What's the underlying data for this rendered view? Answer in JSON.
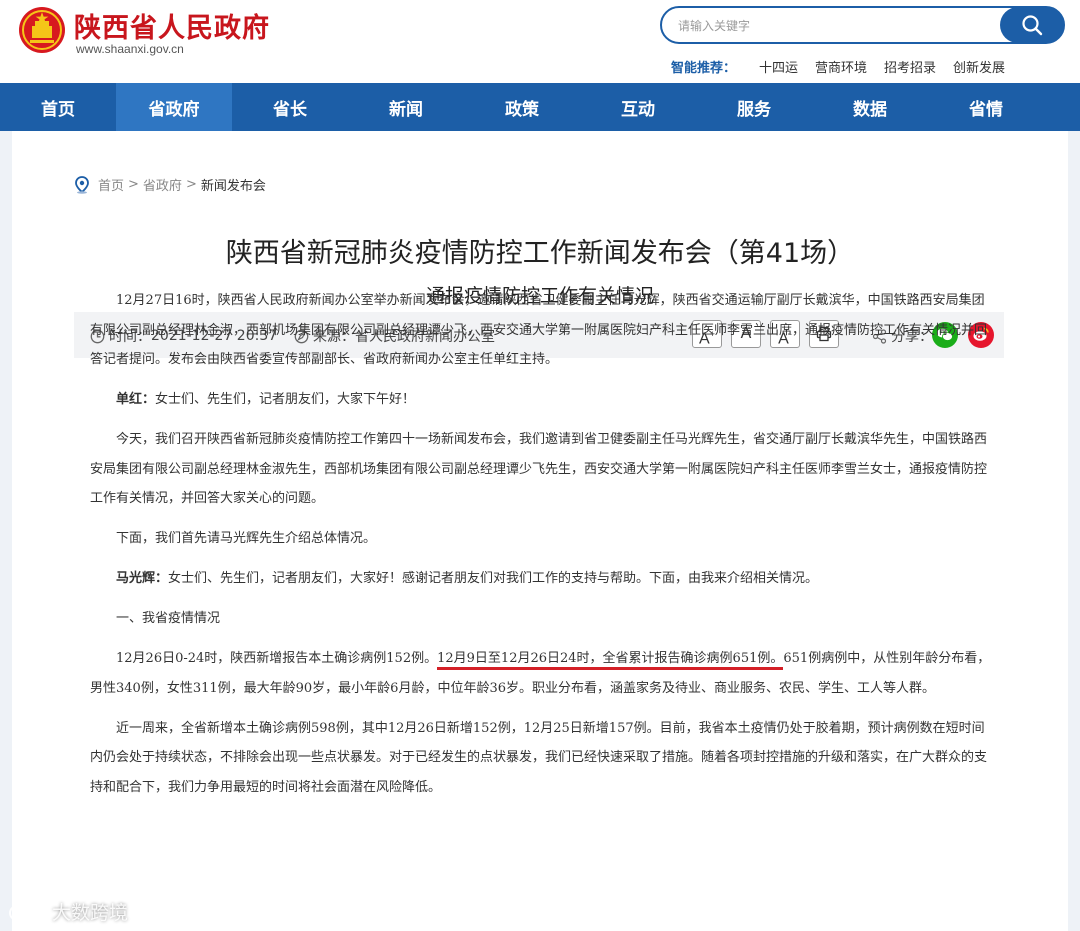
{
  "header": {
    "site_title": "陕西省人民政府",
    "site_url": "www.shaanxi.gov.cn",
    "search_placeholder": "请输入关键字",
    "smart_rec_label": "智能推荐：",
    "smart_links": [
      "十四运",
      "营商环境",
      "招考招录",
      "创新发展"
    ]
  },
  "nav": {
    "items": [
      "首页",
      "省政府",
      "省长",
      "新闻",
      "政策",
      "互动",
      "服务",
      "数据",
      "省情"
    ],
    "active_index": 1
  },
  "breadcrumb": {
    "home": "首页",
    "sep": ">",
    "level2": "省政府",
    "current": "新闻发布会"
  },
  "article": {
    "title": "陕西省新冠肺炎疫情防控工作新闻发布会（第41场）",
    "subtitle": "通报疫情防控工作有关情况",
    "time_label": "时间：",
    "time_value": "2021-12-27 20:37",
    "source_label": "来源：",
    "source_value": "省人民政府新闻办公室",
    "font_buttons": [
      "A+",
      "A",
      "A-"
    ],
    "share_label": "分享：",
    "paragraphs": [
      {
        "text": "12月27日16时，陕西省人民政府新闻办公室举办新闻发布会，邀请陕西省卫健委副主任马光辉，陕西省交通运输厅副厅长戴滨华，中国铁路西安局集团有限公司副总经理林金淑，西部机场集团有限公司副总经理谭少飞，西安交通大学第一附属医院妇产科主任医师李雪兰出席，通报疫情防控工作有关情况并回答记者提问。发布会由陕西省委宣传部副部长、省政府新闻办公室主任单红主持。"
      },
      {
        "speaker": "单红：",
        "text": "女士们、先生们，记者朋友们，大家下午好！"
      },
      {
        "text": "今天，我们召开陕西省新冠肺炎疫情防控工作第四十一场新闻发布会，我们邀请到省卫健委副主任马光辉先生，省交通厅副厅长戴滨华先生，中国铁路西安局集团有限公司副总经理林金淑先生，西部机场集团有限公司副总经理谭少飞先生，西安交通大学第一附属医院妇产科主任医师李雪兰女士，通报疫情防控工作有关情况，并回答大家关心的问题。"
      },
      {
        "text": "下面，我们首先请马光辉先生介绍总体情况。"
      },
      {
        "speaker": "马光辉：",
        "text": "女士们、先生们，记者朋友们，大家好！感谢记者朋友们对我们工作的支持与帮助。下面，由我来介绍相关情况。"
      },
      {
        "text": "一、我省疫情情况"
      },
      {
        "pre": "12月26日0-24时，陕西新增报告本土确诊病例152例。",
        "highlight": "12月9日至12月26日24时，全省累计报告确诊病例651例。",
        "post": "651例病例中，从性别年龄分布看，男性340例，女性311例，最大年龄90岁，最小年龄6月龄，中位年龄36岁。职业分布看，涵盖家务及待业、商业服务、农民、学生、工人等人群。"
      },
      {
        "text": "近一周来，全省新增本土确诊病例598例，其中12月26日新增152例，12月25日新增157例。目前，我省本土疫情仍处于胶着期，预计病例数在短时间内仍会处于持续状态，不排除会出现一些点状暴发。对于已经发生的点状暴发，我们已经快速采取了措施。随着各项封控措施的升级和落实，在广大群众的支持和配合下，我们力争用最短的时间将社会面潜在风险降低。"
      }
    ]
  },
  "watermark": {
    "text": "大数跨境"
  },
  "colors": {
    "brand_red": "#c8161d",
    "nav_blue": "#1c5ea7",
    "nav_active": "#2f76c2",
    "highlight_red": "#d42027",
    "wechat_green": "#1aad19",
    "weibo_red": "#e6162d"
  }
}
